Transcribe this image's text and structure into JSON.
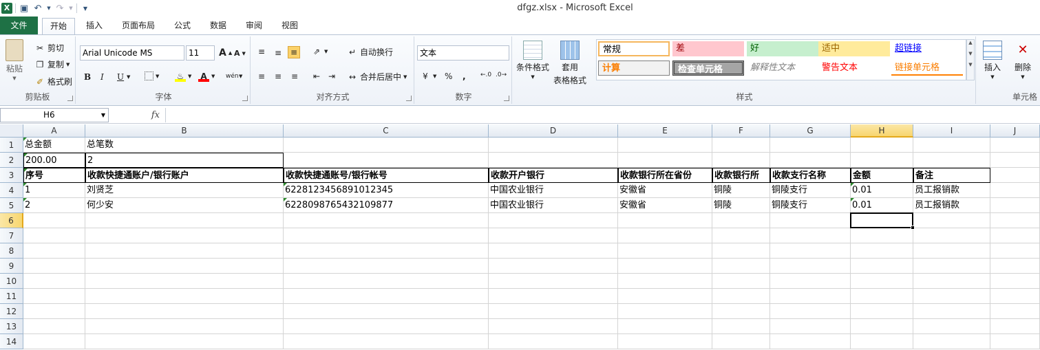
{
  "window": {
    "title": "dfgz.xlsx - Microsoft Excel"
  },
  "tabs": [
    {
      "label": "文件"
    },
    {
      "label": "开始"
    },
    {
      "label": "插入"
    },
    {
      "label": "页面布局"
    },
    {
      "label": "公式"
    },
    {
      "label": "数据"
    },
    {
      "label": "审阅"
    },
    {
      "label": "视图"
    }
  ],
  "ribbon": {
    "clipboard": {
      "paste": "粘贴",
      "cut": "剪切",
      "copy": "复制",
      "format_painter": "格式刷",
      "label": "剪贴板"
    },
    "font": {
      "name": "Arial Unicode MS",
      "size": "11",
      "bold": "B",
      "italic": "I",
      "underline": "U",
      "label": "字体"
    },
    "alignment": {
      "wrap": "自动换行",
      "merge": "合并后居中",
      "label": "对齐方式"
    },
    "number": {
      "format": "文本",
      "percent": "%",
      "comma": ",",
      "label": "数字"
    },
    "styles": {
      "conditional": "条件格式",
      "table_format_1": "套用",
      "table_format_2": "表格格式",
      "cells": [
        {
          "text": "常规",
          "bg": "#ffffff",
          "fg": "#000000"
        },
        {
          "text": "差",
          "bg": "#ffc7ce",
          "fg": "#9c0006"
        },
        {
          "text": "好",
          "bg": "#c6efce",
          "fg": "#006100"
        },
        {
          "text": "适中",
          "bg": "#ffeb9c",
          "fg": "#9c6500"
        },
        {
          "text": "超链接",
          "bg": "#ffffff",
          "fg": "#0000ff"
        },
        {
          "text": "计算",
          "bg": "#f2f2f2",
          "fg": "#fa7d00"
        },
        {
          "text": "检查单元格",
          "bg": "#a5a5a5",
          "fg": "#ffffff"
        },
        {
          "text": "解释性文本",
          "bg": "#ffffff",
          "fg": "#7f7f7f"
        },
        {
          "text": "警告文本",
          "bg": "#ffffff",
          "fg": "#ff0000"
        },
        {
          "text": "链接单元格",
          "bg": "#ffffff",
          "fg": "#fa7d00"
        }
      ],
      "label": "样式"
    },
    "cells_group": {
      "insert": "插入",
      "delete": "删除",
      "label": "单元格"
    }
  },
  "formula_bar": {
    "name_box": "H6",
    "fx": "fx",
    "value": ""
  },
  "sheet": {
    "columns": [
      "A",
      "B",
      "C",
      "D",
      "E",
      "F",
      "G",
      "H",
      "I",
      "J"
    ],
    "rows": [
      "1",
      "2",
      "3",
      "4",
      "5",
      "6",
      "7",
      "8",
      "9",
      "10",
      "11",
      "12",
      "13",
      "14"
    ],
    "selected_cell": "H6",
    "r1": {
      "a": "总金额",
      "b": "总笔数"
    },
    "r2": {
      "a": "200.00",
      "b": "2"
    },
    "header": [
      "序号",
      "收款快捷通账户/银行账户",
      "收款快捷通账号/银行帐号",
      "收款开户银行",
      "收款银行所在省份",
      "收款银行所",
      "收款支行名称",
      "金额",
      "备注"
    ],
    "data": [
      [
        "1",
        "刘贤芝",
        "6228123456891012345",
        "中国农业银行",
        "安徽省",
        "铜陵",
        "铜陵支行",
        "0.01",
        "员工报销款"
      ],
      [
        "2",
        "何少安",
        "6228098765432109877",
        "中国农业银行",
        "安徽省",
        "铜陵",
        "铜陵支行",
        "0.01",
        "员工报销款"
      ]
    ]
  }
}
